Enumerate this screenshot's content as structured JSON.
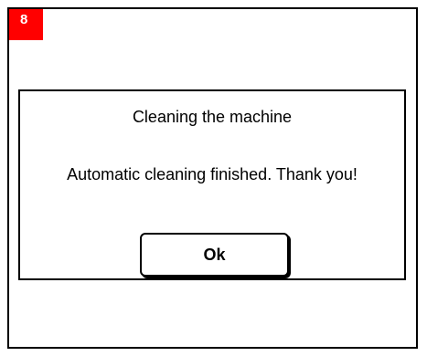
{
  "step": {
    "number": "8",
    "color": "#ff0000"
  },
  "dialog": {
    "title": "Cleaning the machine",
    "message": "Automatic cleaning finished. Thank you!",
    "ok_label": "Ok"
  }
}
